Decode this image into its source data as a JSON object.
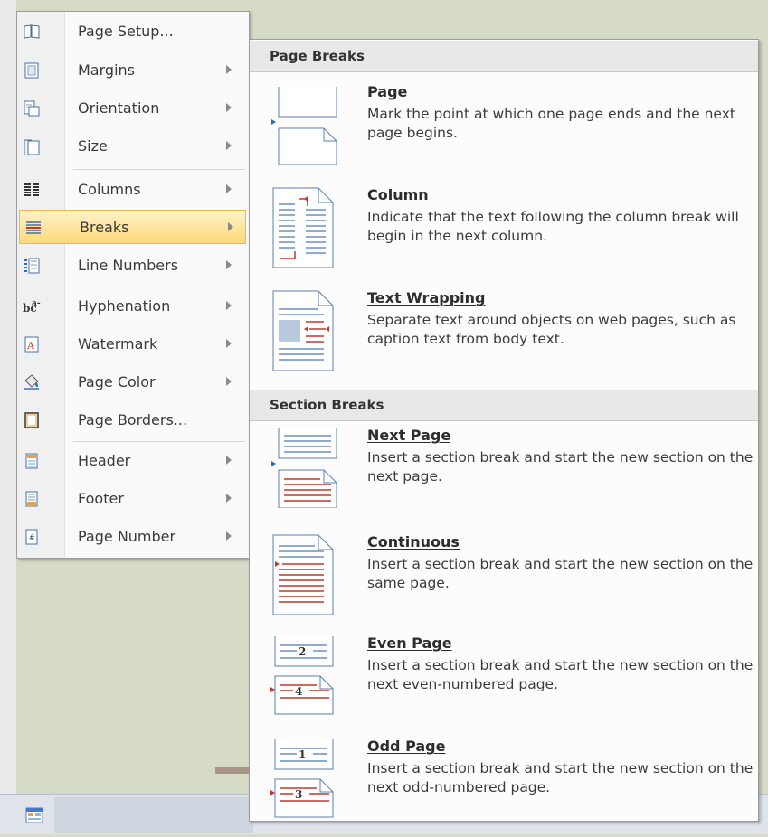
{
  "menu": {
    "items": [
      {
        "label": "Page Setup...",
        "icon": "page-setup-icon",
        "submenu": false
      },
      {
        "label": "Margins",
        "icon": "margins-icon",
        "submenu": true
      },
      {
        "label": "Orientation",
        "icon": "orientation-icon",
        "submenu": true
      },
      {
        "label": "Size",
        "icon": "size-icon",
        "submenu": true
      },
      {
        "label": "Columns",
        "icon": "columns-icon",
        "submenu": true
      },
      {
        "label": "Breaks",
        "icon": "breaks-icon",
        "submenu": true,
        "selected": true
      },
      {
        "label": "Line Numbers",
        "icon": "line-numbers-icon",
        "submenu": true
      },
      {
        "label": "Hyphenation",
        "icon": "hyphenation-icon",
        "submenu": true
      },
      {
        "label": "Watermark",
        "icon": "watermark-icon",
        "submenu": true
      },
      {
        "label": "Page Color",
        "icon": "page-color-icon",
        "submenu": true
      },
      {
        "label": "Page Borders...",
        "icon": "page-borders-icon",
        "submenu": false
      },
      {
        "label": "Header",
        "icon": "header-icon",
        "submenu": true
      },
      {
        "label": "Footer",
        "icon": "footer-icon",
        "submenu": true
      },
      {
        "label": "Page Number",
        "icon": "page-number-icon",
        "submenu": true
      }
    ]
  },
  "submenu": {
    "page_breaks_header": "Page Breaks",
    "section_breaks_header": "Section Breaks",
    "page_breaks": [
      {
        "title": "Page",
        "description": "Mark the point at which one page ends and the next page begins.",
        "icon": "page-break-icon"
      },
      {
        "title": "Column",
        "description": "Indicate that the text following the column break will begin in the next column.",
        "icon": "column-break-icon"
      },
      {
        "title": "Text Wrapping",
        "description": "Separate text around objects on web pages, such as caption text from body text.",
        "icon": "text-wrapping-break-icon"
      }
    ],
    "section_breaks": [
      {
        "title": "Next Page",
        "description": "Insert a section break and start the new section on the next page.",
        "icon": "next-page-break-icon"
      },
      {
        "title": "Continuous",
        "description": "Insert a section break and start the new section on the same page.",
        "icon": "continuous-break-icon"
      },
      {
        "title": "Even Page",
        "description": "Insert a section break and start the new section on the next even-numbered page.",
        "icon": "even-page-break-icon"
      },
      {
        "title": "Odd Page",
        "description": "Insert a section break and start the new section on the next odd-numbered page.",
        "icon": "odd-page-break-icon"
      }
    ]
  },
  "icon_numbers": {
    "even_top": "2",
    "even_bottom": "4",
    "odd_top": "1",
    "odd_bottom": "3"
  },
  "colors": {
    "selection": "#ffd97a",
    "accent_red": "#c0392b",
    "accent_blue": "#2a6db8"
  }
}
